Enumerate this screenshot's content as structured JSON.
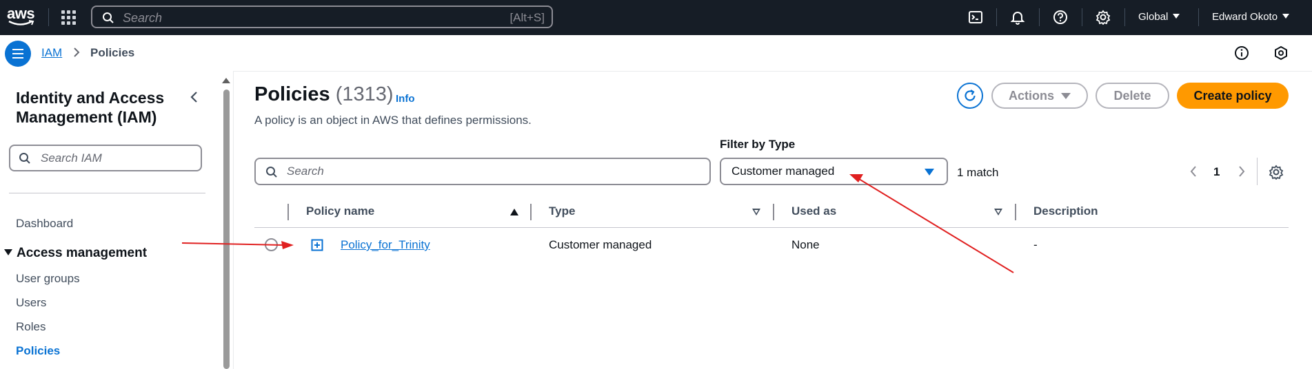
{
  "topbar": {
    "logo_text": "aws",
    "search_placeholder": "Search",
    "search_shortcut": "[Alt+S]",
    "region": "Global",
    "user": "Edward Okoto",
    "icons": [
      "apps-grid-icon",
      "cloudshell-icon",
      "bell-icon",
      "help-icon",
      "settings-icon"
    ]
  },
  "breadcrumb": {
    "root": "IAM",
    "current": "Policies"
  },
  "sidebar": {
    "title": "Identity and Access Management (IAM)",
    "search_placeholder": "Search IAM",
    "dashboard": "Dashboard",
    "section": "Access management",
    "items": [
      {
        "label": "User groups"
      },
      {
        "label": "Users"
      },
      {
        "label": "Roles"
      },
      {
        "label": "Policies"
      }
    ]
  },
  "main": {
    "title": "Policies",
    "count": "(1313)",
    "info": "Info",
    "description": "A policy is an object in AWS that defines permissions.",
    "actions_label": "Actions",
    "delete_label": "Delete",
    "create_label": "Create policy",
    "search_placeholder": "Search",
    "filter_label": "Filter by Type",
    "filter_value": "Customer managed",
    "match_text": "1 match",
    "page": "1"
  },
  "table": {
    "headers": [
      "Policy name",
      "Type",
      "Used as",
      "Description"
    ],
    "rows": [
      {
        "name": "Policy_for_Trinity",
        "type": "Customer managed",
        "used_as": "None",
        "description": "-"
      }
    ]
  },
  "colors": {
    "accent": "#0972d3",
    "primary": "#ff9900",
    "topbar": "#161d26",
    "annotation": "#e02020"
  }
}
